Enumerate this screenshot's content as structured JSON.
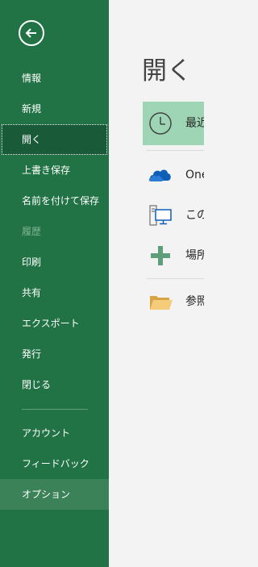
{
  "sidebar": {
    "back_icon": "back-arrow-icon",
    "items": [
      {
        "label": "情報"
      },
      {
        "label": "新規"
      },
      {
        "label": "開く"
      },
      {
        "label": "上書き保存"
      },
      {
        "label": "名前を付けて保存"
      },
      {
        "label": "履歴"
      },
      {
        "label": "印刷"
      },
      {
        "label": "共有"
      },
      {
        "label": "エクスポート"
      },
      {
        "label": "発行"
      },
      {
        "label": "閉じる"
      },
      {
        "label": "アカウント"
      },
      {
        "label": "フィードバック"
      },
      {
        "label": "オプション"
      }
    ],
    "colors": {
      "background": "#217346",
      "active": "#195a38",
      "hover": "#3c8259",
      "disabled_text": "#7fb394"
    }
  },
  "main": {
    "title": "開く",
    "locations": [
      {
        "label": "最近",
        "icon": "clock-icon"
      },
      {
        "label": "One",
        "icon": "onedrive-cloud-icon"
      },
      {
        "label": "この",
        "icon": "this-pc-icon"
      },
      {
        "label": "場所",
        "icon": "add-place-plus-icon"
      },
      {
        "label": "参照",
        "icon": "folder-icon"
      }
    ],
    "colors": {
      "selected": "#9ed5b4",
      "accent": "#217346",
      "onedrive": "#0f5fb8"
    }
  }
}
